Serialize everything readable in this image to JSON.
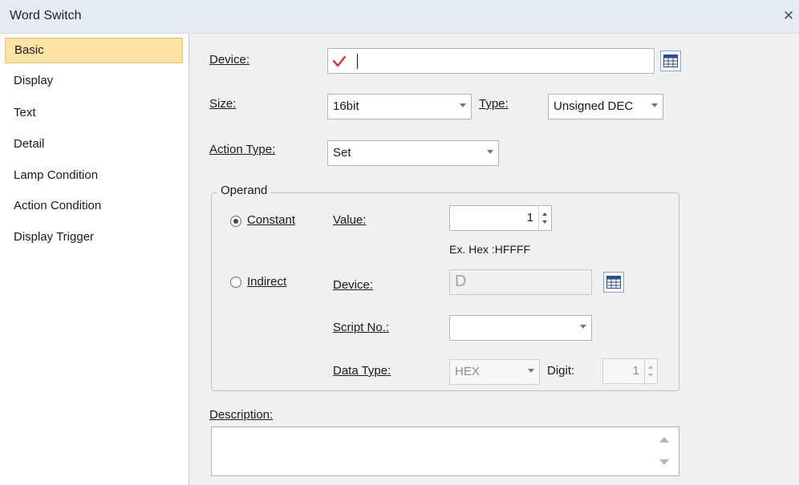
{
  "window": {
    "title": "Word Switch",
    "close_icon": "close-icon"
  },
  "nav": {
    "items": [
      {
        "label": "Basic",
        "active": true
      },
      {
        "label": "Display",
        "active": false
      },
      {
        "label": "Text",
        "active": false
      },
      {
        "label": "Detail",
        "active": false
      },
      {
        "label": "Lamp Condition",
        "active": false
      },
      {
        "label": "Action Condition",
        "active": false
      },
      {
        "label": "Display Trigger",
        "active": false
      }
    ]
  },
  "basic": {
    "device_label": "Device:",
    "device_value": "",
    "size_label": "Size:",
    "size_value": "16bit",
    "type_label": "Type:",
    "type_value": "Unsigned DEC",
    "action_type_label": "Action Type:",
    "action_type_value": "Set",
    "operand_label": "Operand",
    "constant_label": "Constant",
    "value_label": "Value:",
    "value_value": "1",
    "hint": "Ex. Hex :HFFFF",
    "indirect_label": "Indirect",
    "indirect_device_label": "Device:",
    "indirect_device_value": "D",
    "script_label": "Script No.:",
    "script_value": "",
    "data_type_label": "Data Type:",
    "data_type_value": "HEX",
    "digit_label": "Digit:",
    "digit_value": "1",
    "description_label": "Description:",
    "description_value": ""
  },
  "colors": {
    "check_mark": "#e0282b",
    "nav_active_bg": "#fde3a4",
    "titlebar_bg": "#e6ebf3"
  }
}
